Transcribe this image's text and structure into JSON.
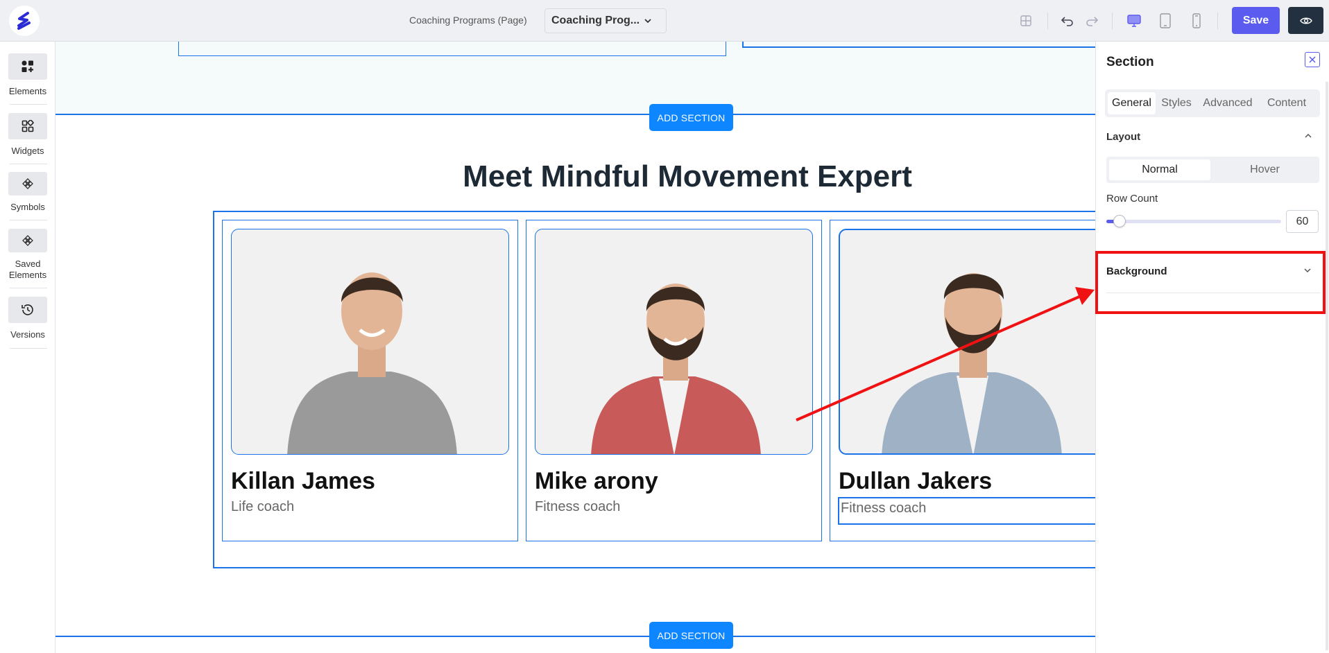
{
  "topbar": {
    "page_label": "Coaching Programs (Page)",
    "page_select_value": "Coaching Prog...",
    "save_label": "Save",
    "icons": [
      "layout-grid-icon",
      "undo-icon",
      "redo-icon",
      "desktop-icon",
      "tablet-icon",
      "mobile-icon",
      "eye-icon"
    ]
  },
  "sidebar": {
    "items": [
      {
        "label": "Elements",
        "icon": "elements-icon"
      },
      {
        "label": "Widgets",
        "icon": "widgets-icon"
      },
      {
        "label": "Symbols",
        "icon": "symbols-icon"
      },
      {
        "label": "Saved Elements",
        "icon": "saved-elements-icon"
      },
      {
        "label": "Versions",
        "icon": "history-icon"
      }
    ]
  },
  "canvas": {
    "add_section_label": "ADD SECTION",
    "section_title": "Meet Mindful Movement Expert",
    "cards": [
      {
        "name": "Killan James",
        "role": "Life coach",
        "shirt": "#9a9a9a"
      },
      {
        "name": "Mike arony",
        "role": "Fitness coach",
        "shirt": "#c85a5a"
      },
      {
        "name": "Dullan Jakers",
        "role": "Fitness coach",
        "shirt": "#9fb1c4"
      }
    ]
  },
  "panel": {
    "title": "Section",
    "tabs": [
      "General",
      "Styles",
      "Advanced",
      "Content"
    ],
    "active_tab": "General",
    "layout_title": "Layout",
    "state_tabs": [
      "Normal",
      "Hover"
    ],
    "active_state": "Normal",
    "row_count_label": "Row Count",
    "row_count_value": "60",
    "row_count_fraction": 0.06,
    "background_title": "Background"
  },
  "colors": {
    "accent": "#5b5bf0",
    "selection_blue": "#1a73e8",
    "add_section_blue": "#0d86ff",
    "annotation_red": "#f01212"
  }
}
